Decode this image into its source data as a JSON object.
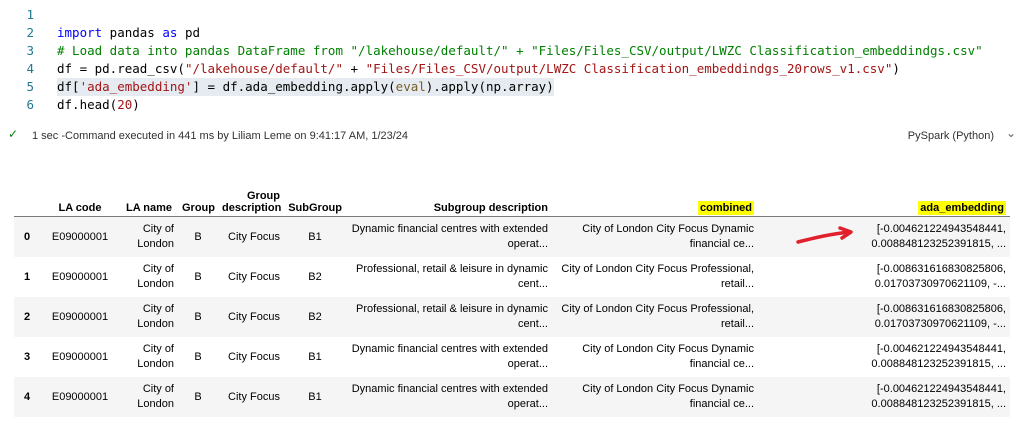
{
  "code": {
    "lines": [
      {
        "num": "1",
        "segments": []
      },
      {
        "num": "2",
        "segments": [
          {
            "t": "kw",
            "v": "import"
          },
          {
            "t": "plain",
            "v": " pandas "
          },
          {
            "t": "kw",
            "v": "as"
          },
          {
            "t": "plain",
            "v": " pd"
          }
        ]
      },
      {
        "num": "3",
        "segments": [
          {
            "t": "cm",
            "v": "# Load data into pandas DataFrame from \"/lakehouse/default/\" + \"Files/Files_CSV/output/LWZC Classification_embeddindgs.csv\""
          }
        ]
      },
      {
        "num": "4",
        "segments": [
          {
            "t": "plain",
            "v": "df = pd.read_csv("
          },
          {
            "t": "str",
            "v": "\"/lakehouse/default/\""
          },
          {
            "t": "plain",
            "v": " + "
          },
          {
            "t": "str",
            "v": "\"Files/Files_CSV/output/LWZC Classification_embeddindgs_20rows_v1.csv\""
          },
          {
            "t": "plain",
            "v": ")"
          }
        ]
      },
      {
        "num": "5",
        "segments": [
          {
            "t": "plain",
            "v": "df["
          },
          {
            "t": "str",
            "v": "'ada_embedding'"
          },
          {
            "t": "plain",
            "v": "] = df.ada_embedding.apply("
          },
          {
            "t": "fn",
            "v": "eval"
          },
          {
            "t": "plain",
            "v": ").apply(np.array)"
          }
        ]
      },
      {
        "num": "6",
        "segments": [
          {
            "t": "plain",
            "v": "df.head("
          },
          {
            "t": "str",
            "v": "20"
          },
          {
            "t": "plain",
            "v": ")"
          }
        ]
      }
    ]
  },
  "status": {
    "text": "1 sec -Command executed in 441 ms by Liliam Leme on 9:41:17 AM, 1/23/24",
    "language": "PySpark (Python)"
  },
  "table": {
    "columns": [
      {
        "label": "",
        "width": 26
      },
      {
        "label": "LA code",
        "width": 80
      },
      {
        "label": "LA name",
        "width": 58
      },
      {
        "label": "Group",
        "width": 40
      },
      {
        "label": "Group description",
        "width": 66
      },
      {
        "label": "SubGroup",
        "width": 62
      },
      {
        "label": "Subgroup description",
        "width": 206
      },
      {
        "label": "combined",
        "width": 206,
        "highlight": true
      },
      {
        "label": "ada_embedding",
        "width": 252,
        "highlight": true
      }
    ],
    "rows": [
      [
        "0",
        "E09000001",
        "City of London",
        "B",
        "City Focus",
        "B1",
        "Dynamic financial centres with extended operat...",
        "City of London City Focus Dynamic financial ce...",
        "[-0.004621224943548441, 0.008848123252391815, ..."
      ],
      [
        "1",
        "E09000001",
        "City of London",
        "B",
        "City Focus",
        "B2",
        "Professional, retail & leisure in dynamic cent...",
        "City of London City Focus Professional, retail...",
        "[-0.008631616830825806, 0.01703730970621109, -..."
      ],
      [
        "2",
        "E09000001",
        "City of London",
        "B",
        "City Focus",
        "B2",
        "Professional, retail & leisure in dynamic cent...",
        "City of London City Focus Professional, retail...",
        "[-0.008631616830825806, 0.01703730970621109, -..."
      ],
      [
        "3",
        "E09000001",
        "City of London",
        "B",
        "City Focus",
        "B1",
        "Dynamic financial centres with extended operat...",
        "City of London City Focus Dynamic financial ce...",
        "[-0.004621224943548441, 0.008848123252391815, ..."
      ],
      [
        "4",
        "E09000001",
        "City of London",
        "B",
        "City Focus",
        "B1",
        "Dynamic financial centres with extended operat...",
        "City of London City Focus Dynamic financial ce...",
        "[-0.004621224943548441, 0.008848123252391815, ..."
      ]
    ]
  },
  "annotation": {
    "arrow_color": "#e0202a",
    "highlight_color": "#ffff00"
  }
}
